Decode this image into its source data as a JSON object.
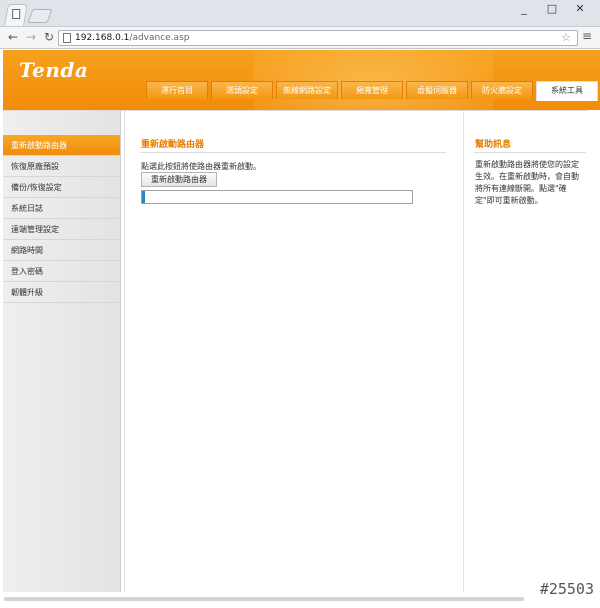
{
  "browser": {
    "url_host": "192.168.0.1",
    "url_path": "/advance.asp",
    "window_buttons": [
      "_",
      "□",
      "✕"
    ]
  },
  "header": {
    "logo": "Tenda",
    "tabs": [
      {
        "label": "運行首目",
        "active": false
      },
      {
        "label": "選頭設定",
        "active": false
      },
      {
        "label": "無線網路設定",
        "active": false
      },
      {
        "label": "頻寬管理",
        "active": false
      },
      {
        "label": "虛擬伺服器",
        "active": false
      },
      {
        "label": "防火牆設定",
        "active": false
      },
      {
        "label": "系統工具",
        "active": true
      }
    ]
  },
  "sidebar": {
    "items": [
      {
        "label": "重新啟動路由器",
        "active": true
      },
      {
        "label": "恢復原廠預設",
        "active": false
      },
      {
        "label": "備份/恢復設定",
        "active": false
      },
      {
        "label": "系統日誌",
        "active": false
      },
      {
        "label": "遠端管理設定",
        "active": false
      },
      {
        "label": "網路時間",
        "active": false
      },
      {
        "label": "登入密碼",
        "active": false
      },
      {
        "label": "韌體升級",
        "active": false
      }
    ]
  },
  "main": {
    "title": "重新啟動路由器",
    "instruction": "點選此按鈕將使路由器重新啟動。",
    "button_label": "重新啟動路由器",
    "progress": 0.01
  },
  "help": {
    "title": "幫助訊息",
    "text": "重新啟動路由器將使您的設定生效。在重新啟動時，會自動將所有連線斷開。點選\"確定\"即可重新啟動。"
  },
  "watermark": "#25503",
  "colors": {
    "accent": "#f28c09",
    "progress": "#2c86b8"
  }
}
